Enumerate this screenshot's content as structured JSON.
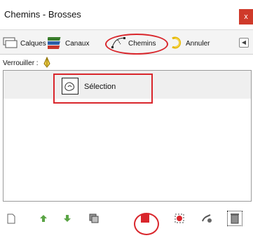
{
  "dialog": {
    "title": "Chemins - Brosses",
    "close_glyph": "x"
  },
  "tabs": [
    {
      "label": "Calques",
      "icon": "layers-icon"
    },
    {
      "label": "Canaux",
      "icon": "channels-icon"
    },
    {
      "label": "Chemins",
      "icon": "paths-icon"
    },
    {
      "label": "Annuler",
      "icon": "undo-history-icon"
    }
  ],
  "tab_scroll_glyph": "◀",
  "lock": {
    "label": "Verrouiller :",
    "icon": "lock-pen-icon"
  },
  "paths": [
    {
      "name": "Sélection",
      "thumbnail_icon": "path-thumbnail-icon"
    }
  ],
  "toolbar": [
    {
      "name": "new-path",
      "icon": "new-document-icon"
    },
    {
      "name": "raise-path",
      "icon": "arrow-up-icon"
    },
    {
      "name": "lower-path",
      "icon": "arrow-down-icon"
    },
    {
      "name": "duplicate-path",
      "icon": "duplicate-icon"
    },
    {
      "name": "path-to-selection",
      "icon": "path-to-selection-icon"
    },
    {
      "name": "selection-to-path",
      "icon": "selection-to-path-icon"
    },
    {
      "name": "stroke-path",
      "icon": "paint-path-icon"
    },
    {
      "name": "delete-path",
      "icon": "trash-icon"
    }
  ],
  "colors": {
    "annotation": "#d9262c",
    "close": "#cf3a2a",
    "arrow": "#5aa445"
  }
}
